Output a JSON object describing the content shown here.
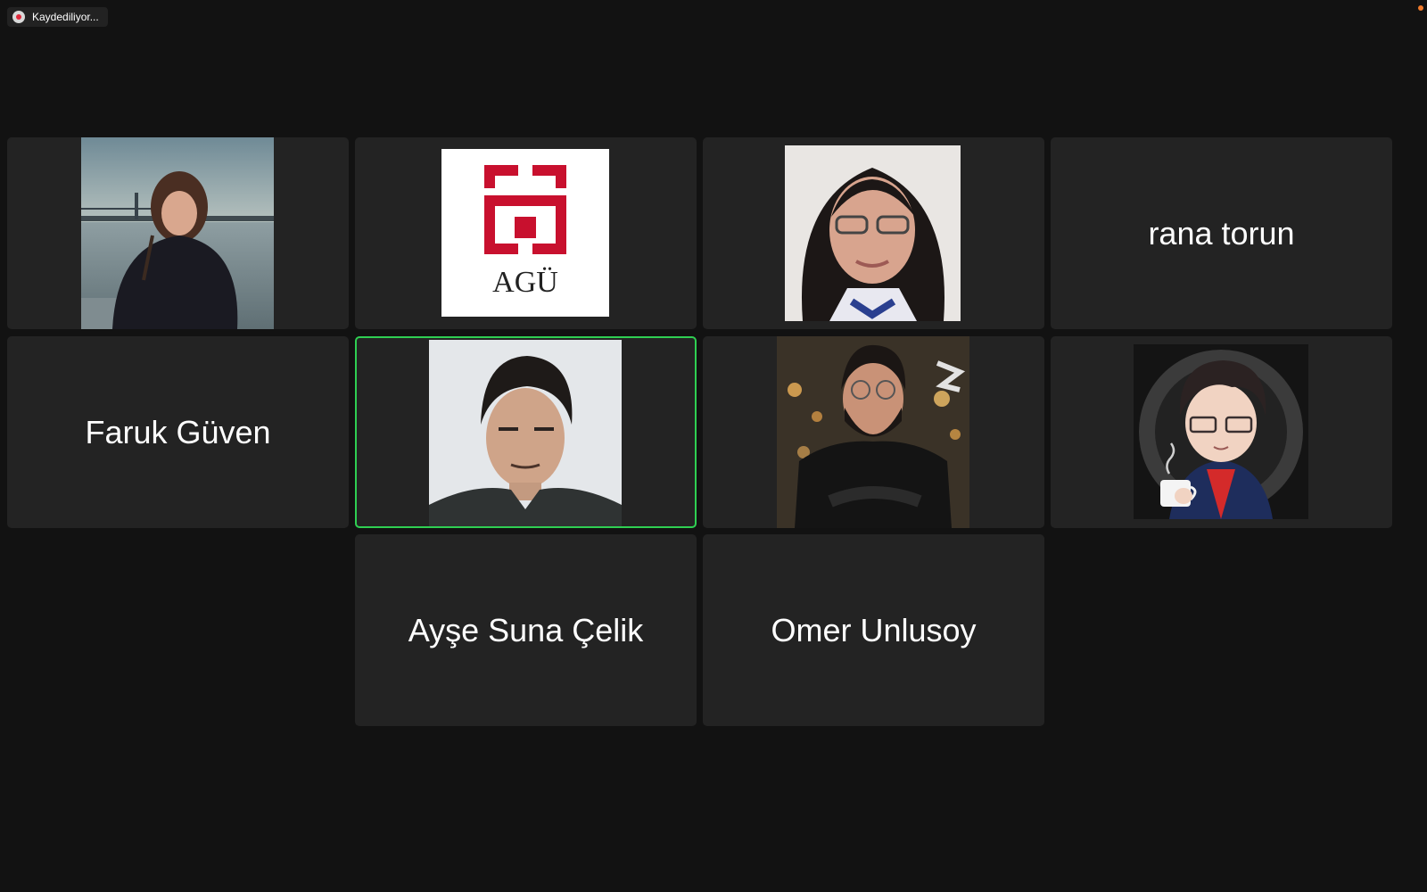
{
  "recording": {
    "label": "Kaydediliyor...",
    "icon": "record-icon"
  },
  "colors": {
    "background": "#121212",
    "tile": "#232323",
    "active_speaker": "#2fcf52",
    "record_dot": "#e0283a",
    "agu_red": "#c8102e"
  },
  "participants": [
    {
      "name": "rana torun"
    },
    {
      "name": "Faruk Güven"
    },
    {
      "name": "Ayşe Suna Çelik"
    },
    {
      "name": "Omer Unlusoy"
    }
  ],
  "video_tiles": [
    {
      "kind": "photo",
      "depicts": "woman-by-waterfront"
    },
    {
      "kind": "logo",
      "text": "AGÜ"
    },
    {
      "kind": "photo",
      "depicts": "woman-with-glasses"
    },
    {
      "kind": "photo",
      "depicts": "young-man-portrait",
      "active_speaker": true
    },
    {
      "kind": "photo",
      "depicts": "bearded-man-with-glasses"
    },
    {
      "kind": "avatar",
      "depicts": "cartoon-person-with-coffee"
    }
  ]
}
